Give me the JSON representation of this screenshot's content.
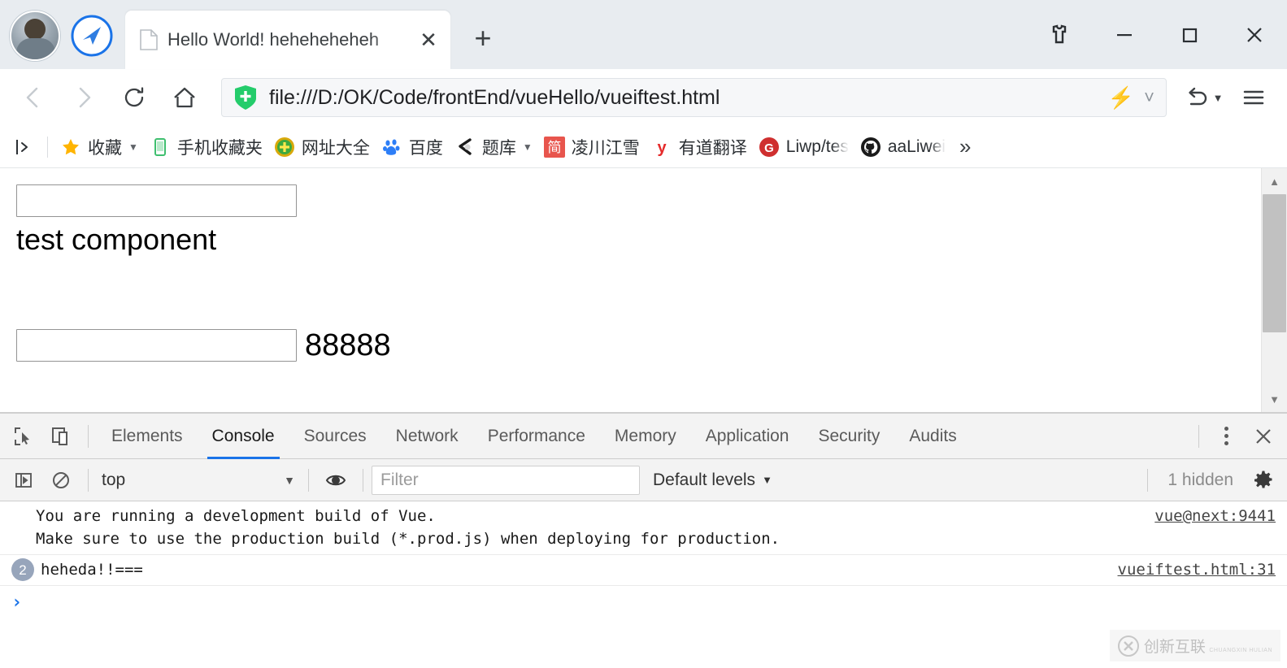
{
  "browser": {
    "tab": {
      "title": "Hello World! heheheheheh",
      "favicon_icon": "document-icon",
      "close_icon": "close-icon"
    },
    "new_tab_label": "+",
    "window_controls": [
      {
        "name": "skin-button",
        "glyph": "skin-icon"
      },
      {
        "name": "minimize-button",
        "glyph": "minimize-icon"
      },
      {
        "name": "maximize-button",
        "glyph": "maximize-icon"
      },
      {
        "name": "close-window-button",
        "glyph": "close-icon"
      }
    ],
    "nav": {
      "back_icon": "back-arrow-icon",
      "forward_icon": "forward-arrow-icon",
      "reload_icon": "reload-icon",
      "home_icon": "home-icon",
      "undo_icon": "undo-icon",
      "menu_icon": "hamburger-menu-icon"
    },
    "omnibox": {
      "url": "file:///D:/OK/Code/frontEnd/vueHello/vueiftest.html",
      "security_icon": "green-shield-icon",
      "bolt_icon": "lightning-icon",
      "dropdown_icon": "chevron-down-icon",
      "accent_green": "#15d66f"
    },
    "bookmarks": {
      "expand_icon": "expand-panel-icon",
      "items": [
        {
          "label": "收藏",
          "icon": "star-icon",
          "has_caret": true
        },
        {
          "label": "手机收藏夹",
          "icon": "phone-icon",
          "has_caret": false
        },
        {
          "label": "网址大全",
          "icon": "plus-circle-icon",
          "has_caret": false
        },
        {
          "label": "百度",
          "icon": "baidu-paw-icon",
          "has_caret": false
        },
        {
          "label": "题库",
          "icon": "tiku-icon",
          "has_caret": true
        },
        {
          "label": "凌川江雪",
          "icon": "jianshu-icon",
          "has_caret": false
        },
        {
          "label": "有道翻译",
          "icon": "youdao-icon",
          "has_caret": false
        },
        {
          "label": "Liwp/tes",
          "icon": "gitee-icon",
          "has_caret": false
        },
        {
          "label": "aaLiwei",
          "icon": "github-icon",
          "has_caret": false
        }
      ],
      "overflow_label": "»"
    }
  },
  "page": {
    "input_top": {
      "value": "",
      "placeholder": ""
    },
    "heading": "test component",
    "input_bottom": {
      "value": "",
      "placeholder": ""
    },
    "counter": "88888"
  },
  "devtools": {
    "inspect_icon": "inspect-element-icon",
    "device_icon": "device-toolbar-icon",
    "tabs": [
      {
        "label": "Elements",
        "active": false
      },
      {
        "label": "Console",
        "active": true
      },
      {
        "label": "Sources",
        "active": false
      },
      {
        "label": "Network",
        "active": false
      },
      {
        "label": "Performance",
        "active": false
      },
      {
        "label": "Memory",
        "active": false
      },
      {
        "label": "Application",
        "active": false
      },
      {
        "label": "Security",
        "active": false
      },
      {
        "label": "Audits",
        "active": false
      }
    ],
    "more_icon": "kebab-menu-icon",
    "close_icon": "close-icon",
    "filterbar": {
      "sidebar_icon": "console-sidebar-icon",
      "clear_icon": "clear-console-icon",
      "context": "top",
      "context_caret": "▼",
      "eye_icon": "live-expression-icon",
      "filter_placeholder": "Filter",
      "filter_value": "",
      "levels_label": "Default levels",
      "levels_caret": "▼",
      "hidden_label": "1 hidden",
      "settings_icon": "gear-icon"
    },
    "messages": [
      {
        "text": "You are running a development build of Vue.\nMake sure to use the production build (*.prod.js) when deploying for production.",
        "source": "vue@next:9441",
        "count": null
      },
      {
        "text": "heheda!!===",
        "source": "vueiftest.html:31",
        "count": "2"
      }
    ],
    "prompt_glyph": "›"
  },
  "watermark": {
    "text": "创新互联",
    "subtext": "CHUANGXIN HULIAN",
    "logo_icon": "cx-logo-icon"
  }
}
